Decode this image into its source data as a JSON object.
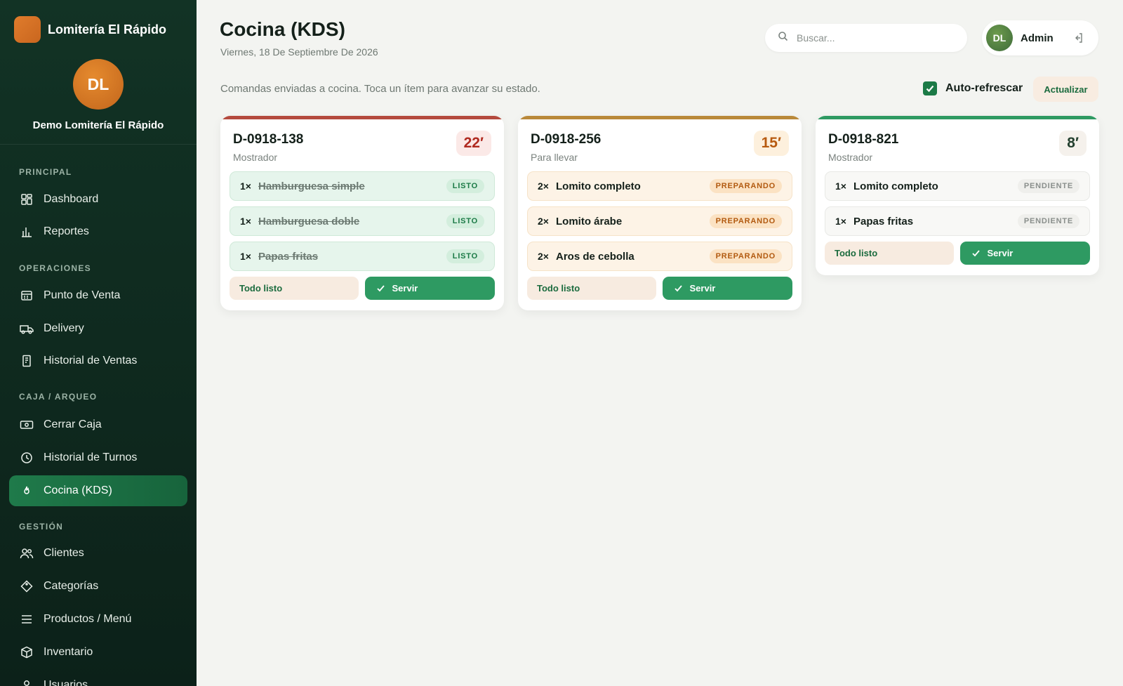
{
  "brand": {
    "name": "Lomitería El Rápido"
  },
  "profile": {
    "initials": "DL",
    "name": "Demo Lomitería El Rápido"
  },
  "sidebar": {
    "sections": [
      {
        "title": "PRINCIPAL"
      },
      {
        "title": "OPERACIONES"
      },
      {
        "title": "CAJA / ARQUEO"
      },
      {
        "title": "GESTIÓN"
      }
    ],
    "items": [
      {
        "label": "Dashboard",
        "icon": "grid-icon"
      },
      {
        "label": "Reportes",
        "icon": "bar-chart-icon"
      },
      {
        "label": "Punto de Venta",
        "icon": "register-icon"
      },
      {
        "label": "Delivery",
        "icon": "truck-icon"
      },
      {
        "label": "Historial de Ventas",
        "icon": "receipt-icon"
      },
      {
        "label": "Cerrar Caja",
        "icon": "cash-icon"
      },
      {
        "label": "Historial de Turnos",
        "icon": "clock-icon"
      },
      {
        "label": "Cocina (KDS)",
        "icon": "flame-icon"
      },
      {
        "label": "Clientes",
        "icon": "users-icon"
      },
      {
        "label": "Categorías",
        "icon": "tag-icon"
      },
      {
        "label": "Productos / Menú",
        "icon": "menu-icon"
      },
      {
        "label": "Inventario",
        "icon": "box-icon"
      },
      {
        "label": "Usuarios",
        "icon": "user-icon"
      }
    ]
  },
  "header": {
    "title": "Cocina (KDS)",
    "date": "Viernes, 18 De Septiembre De 2026",
    "search_placeholder": "Buscar...",
    "user_initials": "DL",
    "user_name": "Admin"
  },
  "toolbar": {
    "subtitle": "Comandas enviadas a cocina. Toca un ítem para avanzar su estado.",
    "autorefresh_label": "Auto-refrescar",
    "autorefresh_checked": true,
    "refresh_label": "Actualizar"
  },
  "actions": {
    "ready_label": "Todo listo",
    "serve_label": "Servir"
  },
  "colors": {
    "late": "#b44a3e",
    "mid": "#b9893a",
    "fresh": "#2e9a62",
    "accent": "#1b7a46"
  },
  "orders": [
    {
      "id": "D-0918-138",
      "type": "Mostrador",
      "timer": "22′",
      "items": [
        {
          "qty": "1×",
          "name": "Hamburguesa simple",
          "status": "LISTO"
        },
        {
          "qty": "1×",
          "name": "Hamburguesa doble",
          "status": "LISTO"
        },
        {
          "qty": "1×",
          "name": "Papas fritas",
          "status": "LISTO"
        }
      ]
    },
    {
      "id": "D-0918-256",
      "type": "Para llevar",
      "timer": "15′",
      "items": [
        {
          "qty": "2×",
          "name": "Lomito completo",
          "status": "PREPARANDO"
        },
        {
          "qty": "2×",
          "name": "Lomito árabe",
          "status": "PREPARANDO"
        },
        {
          "qty": "2×",
          "name": "Aros de cebolla",
          "status": "PREPARANDO"
        }
      ]
    },
    {
      "id": "D-0918-821",
      "type": "Mostrador",
      "timer": "8′",
      "items": [
        {
          "qty": "1×",
          "name": "Lomito completo",
          "status": "PENDIENTE"
        },
        {
          "qty": "1×",
          "name": "Papas fritas",
          "status": "PENDIENTE"
        }
      ]
    }
  ]
}
